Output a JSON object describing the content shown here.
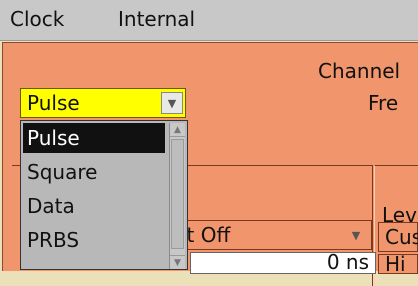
{
  "menubar": {
    "items": [
      {
        "label": "Clock"
      },
      {
        "label": "Internal"
      }
    ]
  },
  "panel": {
    "title": "Channel",
    "freq_label": "Fre",
    "level_label": "Lev"
  },
  "waveform_select": {
    "value": "Pulse",
    "options": [
      "Pulse",
      "Square",
      "Data",
      "PRBS"
    ],
    "highlighted_index": 0
  },
  "output_select": {
    "value": "ıt Off"
  },
  "value_field": {
    "value": "0 ns"
  },
  "right_fields": {
    "top": "Cus",
    "bottom": "Hi"
  },
  "colors": {
    "menubar": "#c8c8c8",
    "panel": "#f0956c",
    "select_highlight": "#ffff00",
    "dropdown": "#b8b8b8",
    "selected_option": "#111111"
  }
}
